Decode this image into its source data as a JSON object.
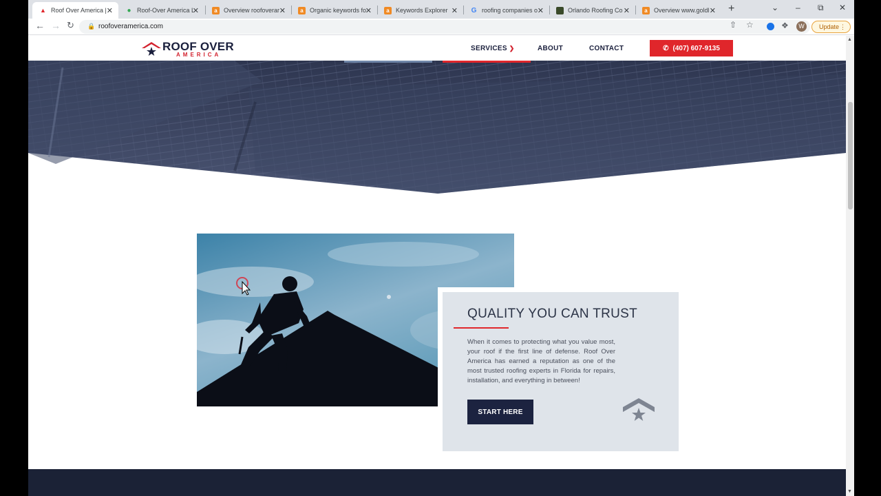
{
  "browser": {
    "tabs": [
      {
        "title": "Roof Over America |",
        "favicon": "roof-logo-icon",
        "active": true
      },
      {
        "title": "Roof-Over America L",
        "favicon": "maps-pin-icon",
        "active": false
      },
      {
        "title": "Overview roofoverar",
        "favicon": "ahrefs-icon",
        "active": false
      },
      {
        "title": "Organic keywords fo",
        "favicon": "ahrefs-icon",
        "active": false
      },
      {
        "title": "Keywords Explorer",
        "favicon": "ahrefs-icon",
        "active": false
      },
      {
        "title": "roofing companies o",
        "favicon": "google-icon",
        "active": false
      },
      {
        "title": "Orlando Roofing Co",
        "favicon": "site-icon",
        "active": false
      },
      {
        "title": "Overview www.goldl",
        "favicon": "ahrefs-icon",
        "active": false
      }
    ],
    "url": "roofoveramerica.com",
    "update_label": "Update",
    "profile_initial": "W"
  },
  "site": {
    "logo_line1": "ROOF OVER",
    "logo_line2": "AMERICA",
    "nav": {
      "services": "SERVICES",
      "about": "ABOUT",
      "contact": "CONTACT"
    },
    "phone": "(407) 607-9135"
  },
  "feature": {
    "title": "QUALITY YOU CAN TRUST",
    "body": "When it comes to protecting what you value most, your roof if the first line of defense. Roof Over America has earned a reputation as one of the most trusted roofing experts in Florida for repairs, installation, and everything in between!",
    "cta": "START HERE"
  },
  "colors": {
    "brand_navy": "#1c2340",
    "brand_red": "#e0262b",
    "card_bg": "#dfe4ea"
  }
}
